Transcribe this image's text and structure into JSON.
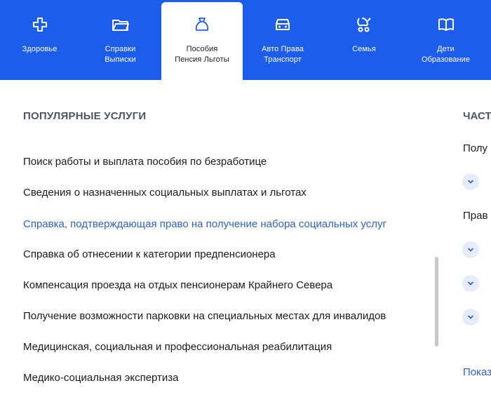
{
  "nav": {
    "tabs": [
      {
        "label": "Здоровье",
        "icon": "health-cross-icon"
      },
      {
        "label": "Справки\nВыписки",
        "icon": "folder-icon"
      },
      {
        "label": "Пособия\nПенсия Льготы",
        "icon": "money-bag-icon",
        "active": true
      },
      {
        "label": "Авто Права\nТранспорт",
        "icon": "car-icon"
      },
      {
        "label": "Семья",
        "icon": "stroller-icon"
      },
      {
        "label": "Дети\nОбразование",
        "icon": "book-icon"
      }
    ]
  },
  "popular": {
    "title": "ПОПУЛЯРНЫЕ УСЛУГИ",
    "items": [
      "Поиск работы и выплата пособия по безработице",
      "Сведения о назначенных социальных выплатах и льготах",
      "Справка, подтверждающая право на получение набора социальных услуг",
      "Справка об отнесении к категории предпенсионера",
      "Компенсация проезда на отдых пенсионерам Крайнего Севера",
      "Получение возможности парковки на специальных местах для инвалидов",
      "Медицинская, социальная и профессиональная реабилитация",
      "Медико-социальная экспертиза"
    ],
    "highlighted_index": 2
  },
  "right_panel": {
    "title": "ЧАСТ",
    "text1": "Полу",
    "text2": "Прав",
    "link": "Показ"
  },
  "colors": {
    "brand_blue": "#1d5deb",
    "link_blue": "#2d63c9",
    "heading_gray": "#4d5660"
  }
}
